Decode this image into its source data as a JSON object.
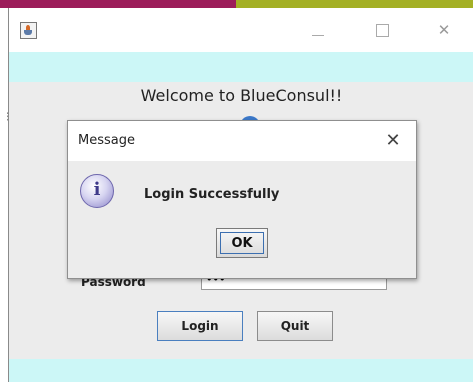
{
  "window": {
    "title_controls": {
      "minimize_icon": "minimize-icon",
      "maximize_icon": "maximize-icon",
      "close_icon": "close-icon",
      "close_glyph": "✕"
    },
    "welcome_text": "Welcome to BlueConsul!!",
    "accent_color": "#ccf7f7"
  },
  "form": {
    "password_label": "Password",
    "password_value": "•••",
    "login_label": "Login",
    "quit_label": "Quit"
  },
  "dialog": {
    "title": "Message",
    "close_glyph": "✕",
    "icon": "info-icon",
    "icon_glyph": "i",
    "message": "Login Successfully",
    "ok_label": "OK"
  }
}
